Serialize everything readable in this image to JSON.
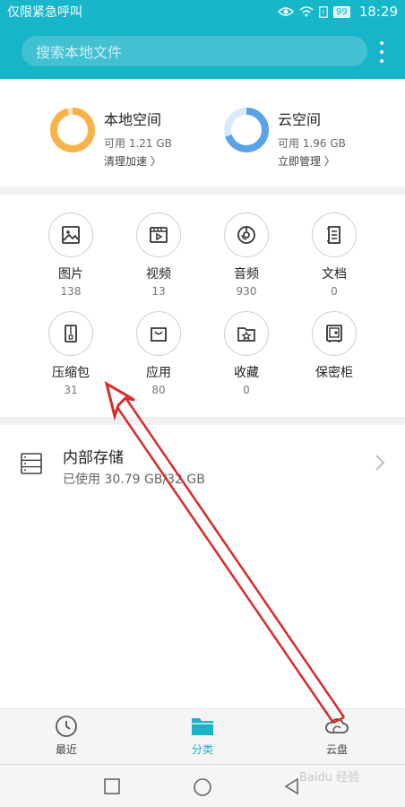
{
  "status_bar": {
    "carrier_text": "仅限紧急呼叫",
    "battery": "99",
    "time": "18:29"
  },
  "search": {
    "placeholder": "搜索本地文件"
  },
  "storage": {
    "local": {
      "title": "本地空间",
      "available": "可用 1.21 GB",
      "action": "清理加速 〉",
      "ring_color": "#f7b34b",
      "used_fraction": 0.96
    },
    "cloud": {
      "title": "云空间",
      "available": "可用 1.96 GB",
      "action": "立即管理 〉",
      "ring_color": "#5aa3e8",
      "used_fraction": 0.7
    }
  },
  "categories": [
    {
      "label": "图片",
      "count": "138",
      "icon": "image-icon"
    },
    {
      "label": "视频",
      "count": "13",
      "icon": "video-icon"
    },
    {
      "label": "音频",
      "count": "930",
      "icon": "audio-icon"
    },
    {
      "label": "文档",
      "count": "0",
      "icon": "document-icon"
    },
    {
      "label": "压缩包",
      "count": "31",
      "icon": "zip-icon"
    },
    {
      "label": "应用",
      "count": "80",
      "icon": "app-bag-icon"
    },
    {
      "label": "收藏",
      "count": "0",
      "icon": "favorite-folder-icon"
    },
    {
      "label": "保密柜",
      "count": "",
      "icon": "safe-icon"
    }
  ],
  "internal_storage": {
    "title": "内部存储",
    "usage": "已使用 30.79 GB/32 GB"
  },
  "bottom_nav": {
    "recent": "最近",
    "category": "分类",
    "cloud": "云盘",
    "active_color": "#19b3c6"
  },
  "watermark": "Baidu 经验"
}
